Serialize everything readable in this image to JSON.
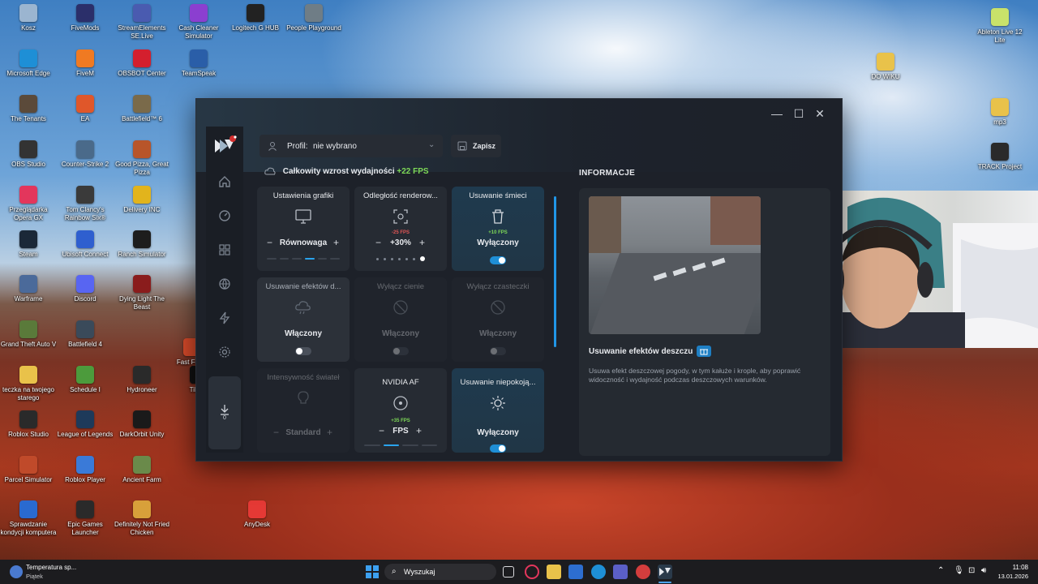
{
  "desktop_icons": [
    {
      "label": "Kosz",
      "color": "#9bb5d0"
    },
    {
      "label": "FiveMods",
      "color": "#2b2f6a"
    },
    {
      "label": "StreamElements SE.Live",
      "color": "#4a5bb0"
    },
    {
      "label": "Cash Cleaner Simulator",
      "color": "#8b3fd0"
    },
    {
      "label": "Logitech G HUB",
      "color": "#222222"
    },
    {
      "label": "People Playground",
      "color": "#6f7d86"
    },
    {
      "label": "Microsoft Edge",
      "color": "#1e8fd6"
    },
    {
      "label": "FiveM",
      "color": "#f07a22"
    },
    {
      "label": "OBSBOT Center",
      "color": "#d41f2e"
    },
    {
      "label": "TeamSpeak",
      "color": "#2a5ea8"
    },
    {
      "label": "The Tenants",
      "color": "#5b4a3a"
    },
    {
      "label": "EA",
      "color": "#e0572a"
    },
    {
      "label": "Battlefield™ 6",
      "color": "#7a6a4a"
    },
    {
      "label": "OBS Studio",
      "color": "#333333"
    },
    {
      "label": "Counter-Strike 2",
      "color": "#4a6a8a"
    },
    {
      "label": "Good Pizza, Great Pizza",
      "color": "#b8552a"
    },
    {
      "label": "Przeglądarka Opera GX",
      "color": "#e3365c"
    },
    {
      "label": "Tom Clancy's Rainbow Six® Sie...",
      "color": "#3a3a3a"
    },
    {
      "label": "Delivery INC",
      "color": "#e2b41c"
    },
    {
      "label": "Steam",
      "color": "#1b2838"
    },
    {
      "label": "Ubisoft Connect",
      "color": "#2f5fcf"
    },
    {
      "label": "Ranch Simulator",
      "color": "#1d1d1d"
    },
    {
      "label": "Warframe",
      "color": "#4b6a9a"
    },
    {
      "label": "Discord",
      "color": "#5865f2"
    },
    {
      "label": "Dying Light The Beast",
      "color": "#8a1c1c"
    },
    {
      "label": "Grand Theft Auto V",
      "color": "#5a7a3a"
    },
    {
      "label": "Battlefield 4",
      "color": "#3a4a5a"
    },
    {
      "label": "teczka na twojego starego",
      "color": "#e9c24a"
    },
    {
      "label": "Schedule I",
      "color": "#4c9b3c"
    },
    {
      "label": "Hydroneer",
      "color": "#2a2a2a"
    },
    {
      "label": "Roblox Studio",
      "color": "#2a2a2a"
    },
    {
      "label": "League of Legends",
      "color": "#1e3a5a"
    },
    {
      "label": "DarkOrbit Unity",
      "color": "#1a1a1a"
    },
    {
      "label": "Parcel Simulator",
      "color": "#c04a2a"
    },
    {
      "label": "Roblox Player",
      "color": "#3a7ad8"
    },
    {
      "label": "Ancient Farm",
      "color": "#6a8a4a"
    },
    {
      "label": "Sprawdzanie kondycji komputera",
      "color": "#2a6ad0"
    },
    {
      "label": "Epic Games Launcher",
      "color": "#2a2a2a"
    },
    {
      "label": "Definitely Not Fried Chicken",
      "color": "#d8a03a"
    },
    {
      "label": "AnyDesk",
      "color": "#e53935"
    },
    {
      "label": "Ableton Live 12 Lite",
      "color": "#c9e26a"
    },
    {
      "label": "DO WIKU",
      "color": "#e9c24a"
    },
    {
      "label": "mp3",
      "color": "#e9c24a"
    },
    {
      "label": "TRACK Project",
      "color": "#2a2a2a"
    },
    {
      "label": "Fast Foo...",
      "color": "#d84a2a"
    },
    {
      "label": "TikTok",
      "color": "#111111"
    }
  ],
  "app": {
    "profile_label": "Profil:",
    "profile_value": "nie wybrano",
    "save_label": "Zapisz",
    "perf_label": "Całkowity wzrost wydajności",
    "perf_value": "+22 FPS",
    "info_title": "INFORMACJE",
    "info_heading": "Usuwanie efektów deszczu",
    "info_desc": "Usuwa efekt deszczowej pogody, w tym kałuże i krople, aby poprawić widoczność i wydajność podczas deszczowych warunków.",
    "download_count": "0",
    "cards": [
      {
        "title": "Ustawienia grafiki",
        "value": "Równowaga",
        "fps": ""
      },
      {
        "title": "Odległość renderow...",
        "value": "+30%",
        "fps": "-25 FPS"
      },
      {
        "title": "Usuwanie śmieci",
        "value": "Wyłączony",
        "fps": "+10 FPS"
      },
      {
        "title": "Usuwanie efektów d...",
        "value": "Włączony",
        "fps": ""
      },
      {
        "title": "Wyłącz cienie",
        "value": "Włączony",
        "fps": ""
      },
      {
        "title": "Wyłącz czasteczki",
        "value": "Włączony",
        "fps": ""
      },
      {
        "title": "Intensywność świateł",
        "value": "Standard",
        "fps": ""
      },
      {
        "title": "NVIDIA AF",
        "value": "FPS",
        "fps": "+35 FPS"
      },
      {
        "title": "Usuwanie niepokoją...",
        "value": "Wyłączony",
        "fps": ""
      }
    ]
  },
  "taskbar": {
    "weather_title": "Temperatura sp...",
    "weather_sub": "Piątek",
    "search_placeholder": "Wyszukaj",
    "time": "11:08",
    "date": "13.01.2026"
  }
}
